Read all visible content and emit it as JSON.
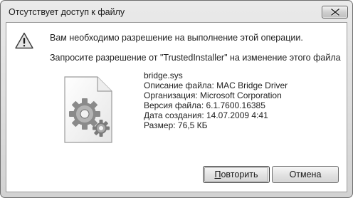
{
  "window": {
    "title": "Отсутствует доступ к файлу"
  },
  "message": {
    "main": "Вам необходимо разрешение на выполнение этой операции.",
    "sub": "Запросите разрешение от \"TrustedInstaller\" на изменение этого файла"
  },
  "file": {
    "name": "bridge.sys",
    "description": "Описание файла: MAC Bridge Driver",
    "company": "Организация: Microsoft Corporation",
    "version": "Версия файла: 6.1.7600.16385",
    "created": "Дата создания: 14.07.2009 4:41",
    "size": "Размер: 76,5 КБ"
  },
  "buttons": {
    "retry_first": "П",
    "retry_rest": "овторить",
    "cancel": "Отмена"
  },
  "icons": {
    "warning": "warning-icon",
    "close": "close-icon",
    "file": "system-file-gears-icon"
  }
}
